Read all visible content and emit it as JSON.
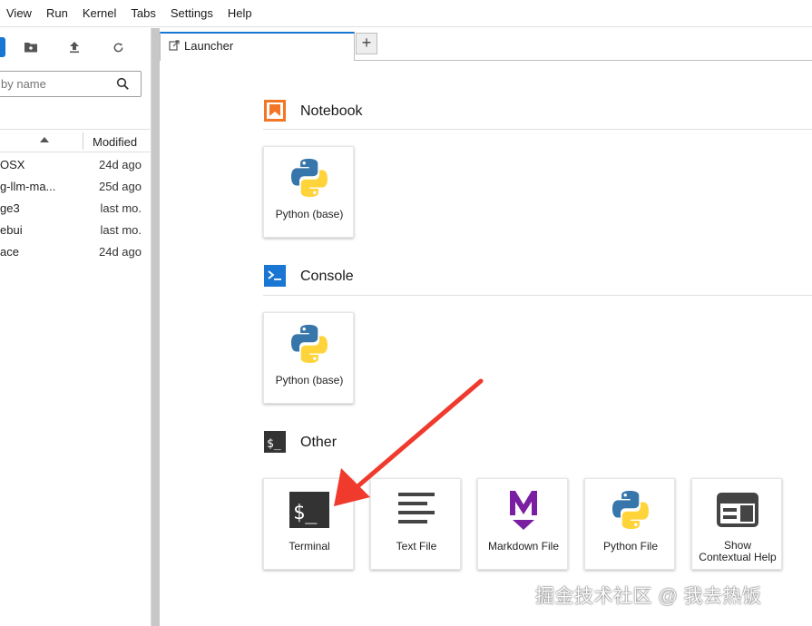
{
  "menubar": {
    "items": [
      "View",
      "Run",
      "Kernel",
      "Tabs",
      "Settings",
      "Help"
    ]
  },
  "file_browser": {
    "search_placeholder": "by name",
    "header": {
      "modified_label": "Modified"
    },
    "files": [
      {
        "name": "OSX",
        "modified": "24d ago"
      },
      {
        "name": "g-llm-ma...",
        "modified": "25d ago"
      },
      {
        "name": "ge3",
        "modified": "last mo."
      },
      {
        "name": "ebui",
        "modified": "last mo."
      },
      {
        "name": "ace",
        "modified": "24d ago"
      }
    ]
  },
  "tabs": [
    {
      "label": "Launcher"
    }
  ],
  "launcher": {
    "sections": {
      "notebook": {
        "title": "Notebook",
        "cards": [
          {
            "label": "Python (base)",
            "icon": "python-logo-icon"
          }
        ]
      },
      "console": {
        "title": "Console",
        "cards": [
          {
            "label": "Python (base)",
            "icon": "python-logo-icon"
          }
        ]
      },
      "other": {
        "title": "Other",
        "cards": [
          {
            "label": "Terminal",
            "icon": "terminal-icon"
          },
          {
            "label": "Text File",
            "icon": "text-file-icon"
          },
          {
            "label": "Markdown File",
            "icon": "markdown-icon"
          },
          {
            "label": "Python File",
            "icon": "python-logo-icon"
          },
          {
            "label_line1": "Show",
            "label_line2": "Contextual Help",
            "icon": "contextual-help-icon"
          }
        ]
      }
    }
  },
  "annotation": {
    "arrow_color": "#f03a2e"
  },
  "watermark": "掘金技术社区 @ 我去热饭",
  "colors": {
    "accent": "#1976d2",
    "notebook_icon": "#f37626",
    "console_icon": "#1976d2",
    "markdown_icon": "#7b1fa2"
  }
}
